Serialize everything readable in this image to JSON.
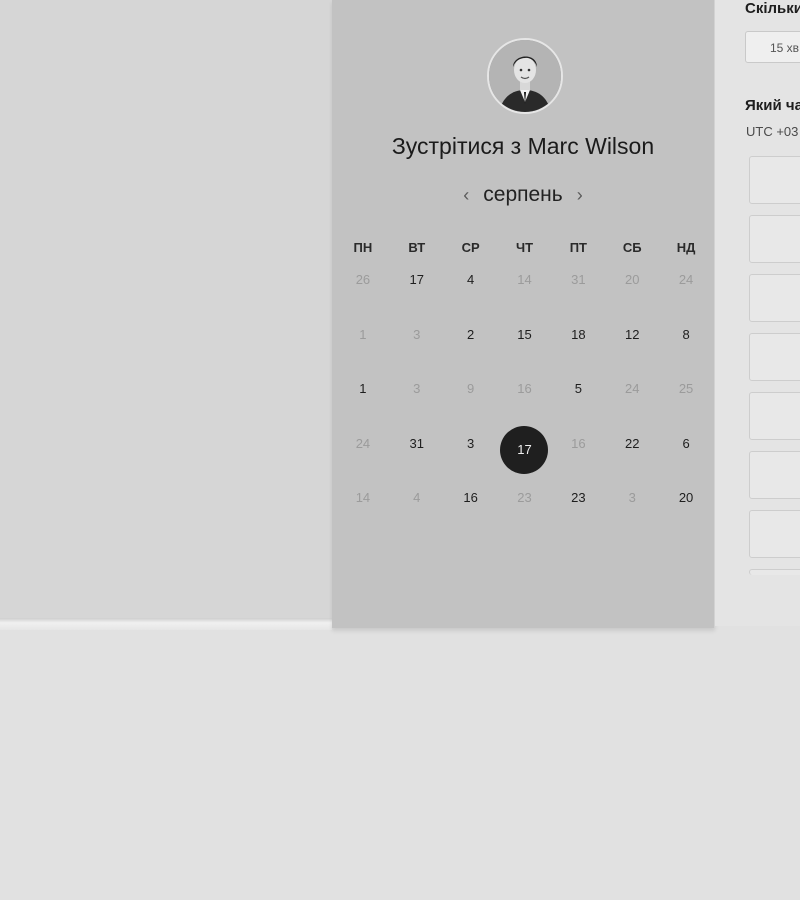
{
  "header": {
    "title": "Зустрітися з Marc Wilson"
  },
  "calendar": {
    "month": "серпень",
    "prev_icon": "chevron-left-icon",
    "next_icon": "chevron-right-icon",
    "weekdays": [
      "ПН",
      "ВТ",
      "СР",
      "ЧТ",
      "ПТ",
      "СБ",
      "НД"
    ],
    "weeks": [
      [
        {
          "d": "26",
          "s": "muted"
        },
        {
          "d": "17",
          "s": "active"
        },
        {
          "d": "4",
          "s": "active"
        },
        {
          "d": "14",
          "s": "muted"
        },
        {
          "d": "31",
          "s": "muted"
        },
        {
          "d": "20",
          "s": "muted"
        },
        {
          "d": "24",
          "s": "muted"
        }
      ],
      [
        {
          "d": "1",
          "s": "muted"
        },
        {
          "d": "3",
          "s": "muted"
        },
        {
          "d": "2",
          "s": "active"
        },
        {
          "d": "15",
          "s": "active"
        },
        {
          "d": "18",
          "s": "active"
        },
        {
          "d": "12",
          "s": "active"
        },
        {
          "d": "8",
          "s": "active"
        }
      ],
      [
        {
          "d": "1",
          "s": "active"
        },
        {
          "d": "3",
          "s": "muted"
        },
        {
          "d": "9",
          "s": "muted"
        },
        {
          "d": "16",
          "s": "muted"
        },
        {
          "d": "5",
          "s": "active"
        },
        {
          "d": "24",
          "s": "muted"
        },
        {
          "d": "25",
          "s": "muted"
        }
      ],
      [
        {
          "d": "24",
          "s": "muted"
        },
        {
          "d": "31",
          "s": "active"
        },
        {
          "d": "3",
          "s": "active"
        },
        {
          "d": "17",
          "s": "selected"
        },
        {
          "d": "16",
          "s": "muted"
        },
        {
          "d": "22",
          "s": "active"
        },
        {
          "d": "6",
          "s": "active"
        }
      ],
      [
        {
          "d": "14",
          "s": "muted"
        },
        {
          "d": "4",
          "s": "muted"
        },
        {
          "d": "16",
          "s": "active"
        },
        {
          "d": "23",
          "s": "muted"
        },
        {
          "d": "23",
          "s": "active"
        },
        {
          "d": "3",
          "s": "muted"
        },
        {
          "d": "20",
          "s": "active"
        }
      ]
    ]
  },
  "right_panel": {
    "duration_question": "Скільки",
    "duration_value": "15 хв",
    "time_question": "Який ча",
    "timezone": "UTC +03"
  },
  "colors": {
    "selected_day_bg": "#1f1f1f",
    "panel_bg": "#c2c2c2"
  }
}
